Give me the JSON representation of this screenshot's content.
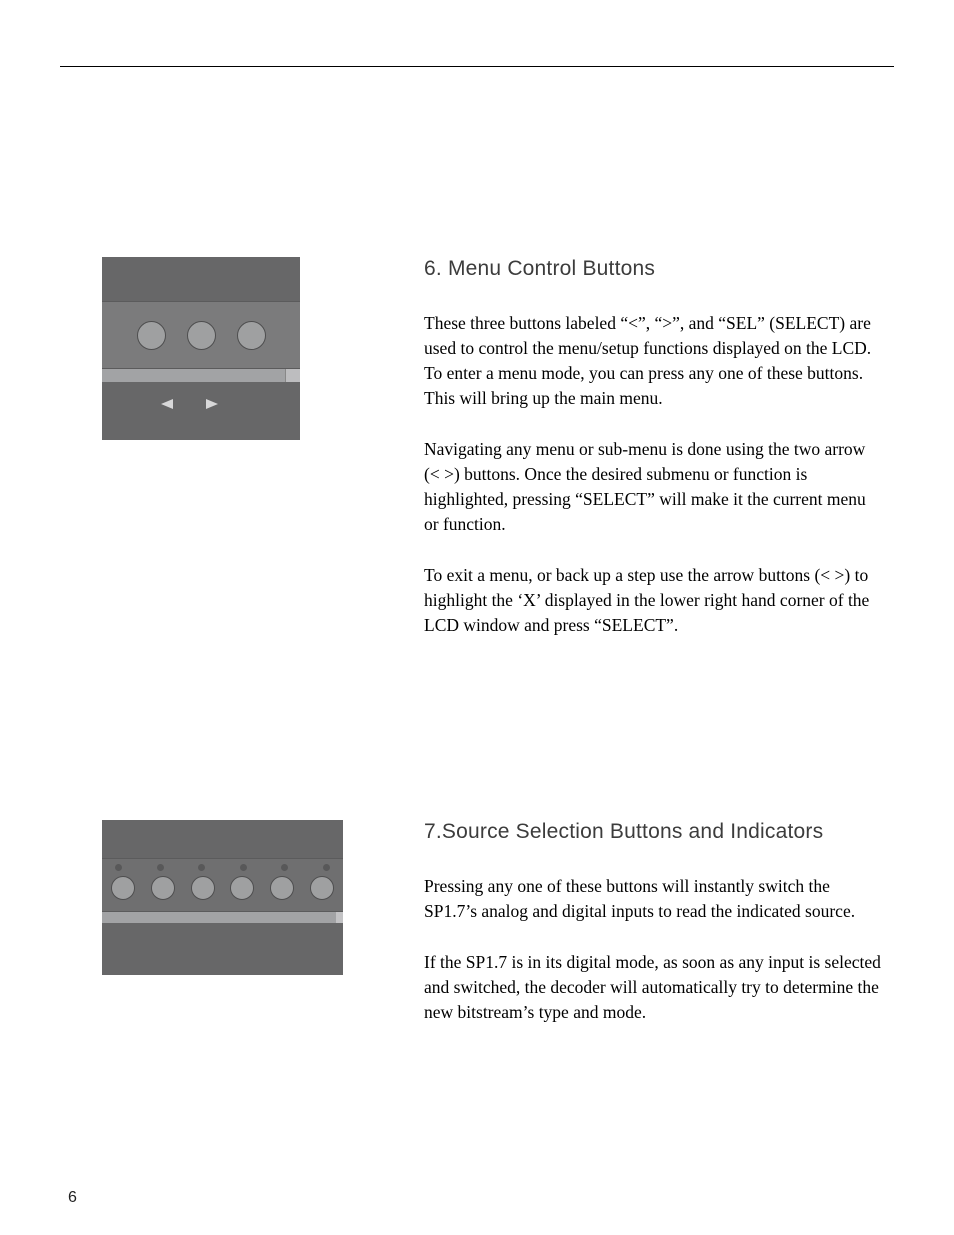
{
  "page_number": "6",
  "section_6": {
    "heading": "6. Menu Control Buttons",
    "para1": "These three buttons labeled “<”, “>”, and “SEL” (SELECT) are used to control the menu/setup functions displayed on the LCD. To enter a menu mode, you can press any one of these buttons. This will bring up the main menu.",
    "para2": "Navigating any menu or sub-menu is done using the two arrow (< >) buttons.  Once the desired submenu or function is highlighted, pressing “SELECT” will make it the current menu or function.",
    "para3": "To exit a menu, or back up a step use the arrow buttons (< >) to highlight the ‘X’ displayed in the lower right hand corner of the LCD window and press “SELECT”."
  },
  "section_7": {
    "heading": "7.Source Selection Buttons and Indicators",
    "para1": "Pressing any one of these buttons will instantly switch the SP1.7’s analog and digital inputs to read the indicated source.",
    "para2": "If the SP1.7 is in its digital mode, as soon as any input is selected and switched, the decoder will automatically try to determine the new bitstream’s type and mode."
  }
}
